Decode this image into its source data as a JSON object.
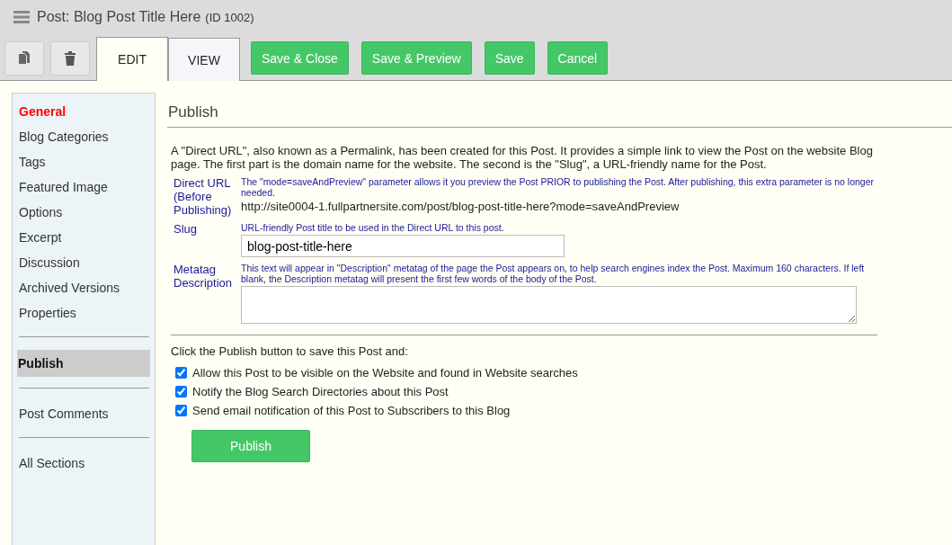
{
  "window": {
    "title": "Post: Blog Post Title Here",
    "title_id": "(ID 1002)"
  },
  "toolbar": {
    "icon_buttons": [
      {
        "kind": "copy"
      },
      {
        "kind": "delete"
      }
    ],
    "tabs": [
      {
        "label": "EDIT",
        "selected": true
      },
      {
        "label": "VIEW",
        "selected": false
      }
    ],
    "buttons": [
      "Save & Close",
      "Save & Preview",
      "Save",
      "Cancel"
    ]
  },
  "sidebar": {
    "groups": [
      {
        "items": [
          {
            "label": "General",
            "kind": "heading",
            "selected": false
          },
          {
            "label": "Blog Categories",
            "kind": "link",
            "selected": false
          },
          {
            "label": "Tags",
            "kind": "link",
            "selected": false
          },
          {
            "label": "Featured Image",
            "kind": "link",
            "selected": false
          },
          {
            "label": "Options",
            "kind": "link",
            "selected": false
          },
          {
            "label": "Excerpt",
            "kind": "link",
            "selected": false
          },
          {
            "label": "Discussion",
            "kind": "link",
            "selected": false
          },
          {
            "label": "Archived Versions",
            "kind": "link",
            "selected": false
          },
          {
            "label": "Properties",
            "kind": "link",
            "selected": false
          }
        ]
      },
      {
        "items": [
          {
            "label": "Publish",
            "kind": "link",
            "selected": true
          }
        ]
      },
      {
        "items": [
          {
            "label": "Post Comments",
            "kind": "link",
            "selected": false
          }
        ]
      },
      {
        "items": [
          {
            "label": "All Sections",
            "kind": "link",
            "selected": false
          }
        ]
      }
    ]
  },
  "section": {
    "title": "Publish",
    "intro": "A \"Direct URL\", also known as a Permalink, has been created for this Post. It provides a simple link to view the Post on the website Blog page. The first part is the domain name for the website. The second is the \"Slug\", a URL-friendly name for the Post.",
    "fields": [
      {
        "kind": "text",
        "label": "Direct URL (Before Publishing)",
        "hint": "The \"mode=saveAndPreview\" parameter allows it you preview the Post PRIOR to publishing the Post. After publishing, this extra parameter is no longer needed.",
        "value": "http://site0004-1.fullpartnersite.com/post/blog-post-title-here?mode=saveAndPreview"
      },
      {
        "kind": "input",
        "label": "Slug",
        "hint": "URL-friendly Post title to be used in the Direct URL to this post.",
        "value": "blog-post-title-here"
      },
      {
        "kind": "textarea",
        "label": "Metatag Description",
        "hint": "This text will appear in \"Description\" metatag of the page the Post appears on, to help search engines index the Post. Maximum 160 characters. If left blank, the Description metatag will present the first few words of the body of the Post."
      }
    ],
    "publish_prompt": "Click the Publish button to save this Post and:",
    "options": [
      {
        "label": "Allow this Post to be visible on the Website and found in Website searches",
        "checked": true
      },
      {
        "label": "Notify the Blog Search Directories about this Post",
        "checked": true
      },
      {
        "label": "Send email notification of this Post to Subscribers to this Blog",
        "checked": true
      }
    ],
    "publish_button": "Publish"
  }
}
